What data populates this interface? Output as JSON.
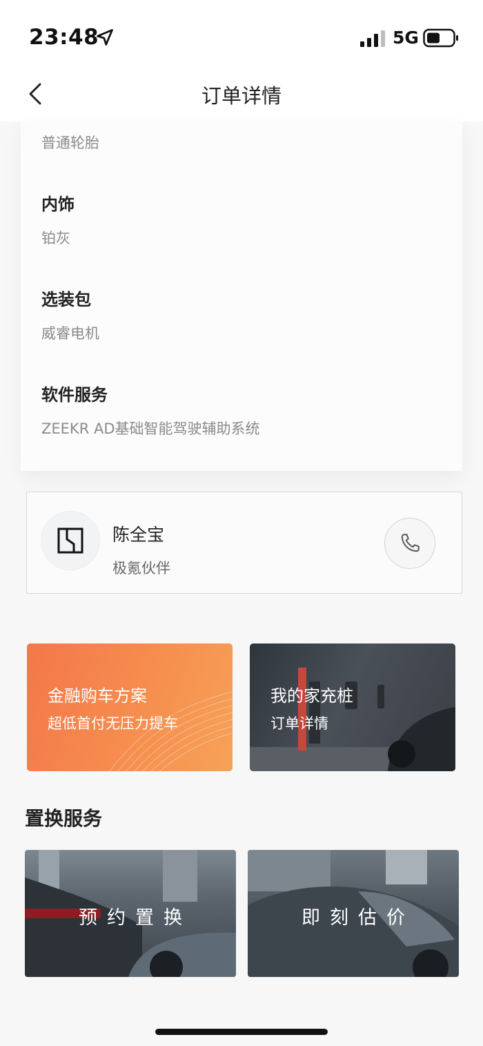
{
  "status_bar": {
    "time": "23:48",
    "network": "5G",
    "icons": [
      "location-arrow-icon",
      "signal-icon",
      "battery-icon"
    ]
  },
  "nav": {
    "title": "订单详情",
    "back_icon": "chevron-left-icon"
  },
  "specs": {
    "tire_value": "普通轮胎",
    "interior_label": "内饰",
    "interior_value": "铂灰",
    "option_label": "选装包",
    "option_value": "威睿电机",
    "software_label": "软件服务",
    "software_value": "ZEEKR AD基础智能驾驶辅助系统"
  },
  "contact": {
    "name": "陈全宝",
    "role": "极氪伙伴",
    "avatar_icon": "brand-logo-icon",
    "call_icon": "phone-icon"
  },
  "promos": [
    {
      "title": "金融购车方案",
      "subtitle": "超低首付无压力提车",
      "color": "#f5844d"
    },
    {
      "title": "我的家充桩",
      "subtitle": "订单详情",
      "color": "#3d434a"
    }
  ],
  "trade": {
    "section_title": "置换服务",
    "reserve_label": "预约置换",
    "estimate_label": "即刻估价"
  }
}
